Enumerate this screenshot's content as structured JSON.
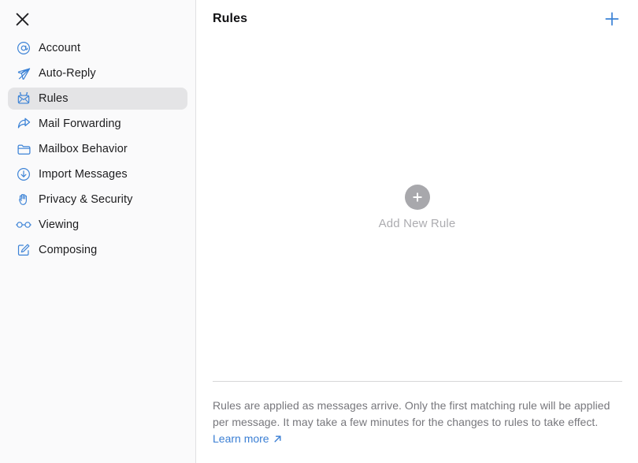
{
  "window": {
    "close_label": "Close settings"
  },
  "sidebar": {
    "items": [
      {
        "label": "Account",
        "icon": "at-sign-circle-icon",
        "name": "sidebar-item-account",
        "selected": false
      },
      {
        "label": "Auto-Reply",
        "icon": "paper-plane-icon",
        "name": "sidebar-item-auto-reply",
        "selected": false
      },
      {
        "label": "Rules",
        "icon": "rules-envelope-icon",
        "name": "sidebar-item-rules",
        "selected": true
      },
      {
        "label": "Mail Forwarding",
        "icon": "forward-arrow-icon",
        "name": "sidebar-item-mail-forwarding",
        "selected": false
      },
      {
        "label": "Mailbox Behavior",
        "icon": "folder-icon",
        "name": "sidebar-item-mailbox-behavior",
        "selected": false
      },
      {
        "label": "Import Messages",
        "icon": "download-circle-icon",
        "name": "sidebar-item-import-messages",
        "selected": false
      },
      {
        "label": "Privacy & Security",
        "icon": "hand-icon",
        "name": "sidebar-item-privacy-security",
        "selected": false
      },
      {
        "label": "Viewing",
        "icon": "glasses-icon",
        "name": "sidebar-item-viewing",
        "selected": false
      },
      {
        "label": "Composing",
        "icon": "compose-icon",
        "name": "sidebar-item-composing",
        "selected": false
      }
    ]
  },
  "main": {
    "title": "Rules",
    "add_button_label": "+",
    "empty_state": {
      "label": "Add New Rule"
    },
    "footer": {
      "text": "Rules are applied as messages arrive. Only the first matching rule will be applied per message. It may take a few minutes for the changes to rules to take effect.",
      "link_label": "Learn more"
    }
  },
  "colors": {
    "accent_blue": "#3b82d6",
    "link_blue": "#3b7fd4",
    "sidebar_bg": "#fafafb",
    "selected_bg": "#e4e4e6",
    "muted_text": "#77777c",
    "placeholder_gray": "#acacb0",
    "circle_gray": "#a8a8ac"
  }
}
